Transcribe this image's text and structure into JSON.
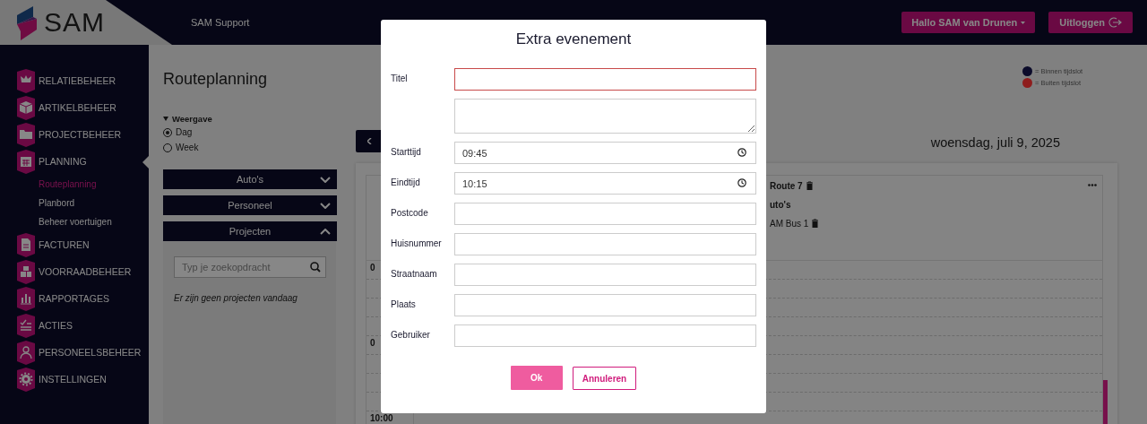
{
  "header": {
    "logo": "SAM",
    "support": "SAM Support",
    "user_button": "Hallo SAM van Drunen",
    "logout_button": "Uitloggen"
  },
  "sidebar": {
    "items": [
      {
        "label": "RELATIEBEHEER",
        "selected": false
      },
      {
        "label": "ARTIKELBEHEER",
        "selected": false
      },
      {
        "label": "PROJECTBEHEER",
        "selected": false
      },
      {
        "label": "PLANNING",
        "selected": true,
        "children": [
          {
            "label": "Routeplanning",
            "selected": true
          },
          {
            "label": "Planbord",
            "selected": false
          },
          {
            "label": "Beheer voertuigen",
            "selected": false
          }
        ]
      },
      {
        "label": "FACTUREN",
        "selected": false
      },
      {
        "label": "VOORRAADBEHEER",
        "selected": false
      },
      {
        "label": "RAPPORTAGES",
        "selected": false
      },
      {
        "label": "ACTIES",
        "selected": false
      },
      {
        "label": "PERSONEELSBEHEER",
        "selected": false
      },
      {
        "label": "INSTELLINGEN",
        "selected": false
      }
    ]
  },
  "page": {
    "title": "Routeplanning",
    "view": {
      "label": "Weergave",
      "options": [
        {
          "label": "Dag",
          "selected": true
        },
        {
          "label": "Week",
          "selected": false
        }
      ]
    },
    "panels": [
      {
        "label": "Auto's",
        "expanded": false
      },
      {
        "label": "Personeel",
        "expanded": false
      },
      {
        "label": "Projecten",
        "expanded": true
      }
    ],
    "search": {
      "placeholder": "Typ je zoekopdracht"
    },
    "empty_message": "Er zijn geen projecten vandaag"
  },
  "legend": [
    {
      "label": "= Binnen tijdslot",
      "color": "#0b0b2a"
    },
    {
      "label": "= Buiten tijdslot",
      "color": "#8e1d1d"
    }
  ],
  "calendar": {
    "date": "woensdag, juli 9, 2025",
    "route": {
      "title": "Route 7",
      "vehicles_heading": "uto's",
      "vehicle": "AM Bus 1"
    },
    "time_labels": [
      "0",
      "0",
      "10:00"
    ]
  },
  "modal": {
    "title": "Extra evenement",
    "fields": [
      {
        "label": "Titel",
        "kind": "text",
        "invalid": true
      },
      {
        "kind": "textarea",
        "invalid": false
      },
      {
        "label": "Starttijd",
        "kind": "time",
        "value": "09:45",
        "invalid": false
      },
      {
        "label": "Eindtijd",
        "kind": "time",
        "value": "10:15",
        "invalid": false
      },
      {
        "label": "Postcode",
        "kind": "text",
        "invalid": false
      },
      {
        "label": "Huisnummer",
        "kind": "text",
        "invalid": false
      },
      {
        "label": "Straatnaam",
        "kind": "text",
        "invalid": false
      },
      {
        "label": "Plaats",
        "kind": "text",
        "invalid": false
      },
      {
        "label": "Gebruiker",
        "kind": "text",
        "invalid": false
      }
    ],
    "buttons": [
      {
        "label": "Ok",
        "kind": "primary"
      },
      {
        "label": "Annuleren",
        "kind": "secondary"
      }
    ]
  }
}
